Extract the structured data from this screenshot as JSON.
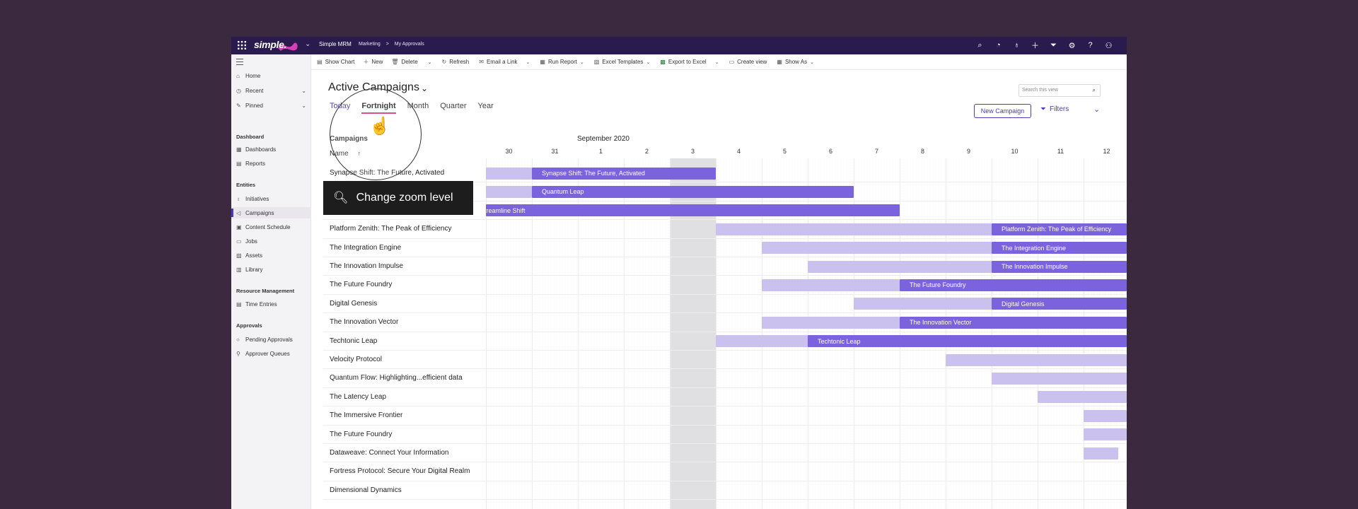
{
  "topbar": {
    "logo_text": "simple.",
    "app_name": "Simple MRM",
    "breadcrumb": [
      "Marketing",
      ">",
      "My Approvals"
    ],
    "icons": [
      "search-icon",
      "compass-icon",
      "lightbulb-icon",
      "plus-icon",
      "filter-icon",
      "settings-icon",
      "help-icon",
      "user-icon"
    ]
  },
  "nav": {
    "items": [
      {
        "label": "Home",
        "icon": "home-icon"
      },
      {
        "label": "Recent",
        "icon": "clock-icon",
        "expandable": true
      },
      {
        "label": "Pinned",
        "icon": "pin-icon",
        "expandable": true
      }
    ],
    "sections": [
      {
        "title": "Dashboard",
        "items": [
          {
            "label": "Dashboards"
          },
          {
            "label": "Reports"
          }
        ]
      },
      {
        "title": "Entities",
        "items": [
          {
            "label": "Initiatives"
          },
          {
            "label": "Campaigns",
            "active": true
          },
          {
            "label": "Content Schedule"
          },
          {
            "label": "Jobs"
          },
          {
            "label": "Assets"
          },
          {
            "label": "Library"
          }
        ]
      },
      {
        "title": "Resource Management",
        "items": [
          {
            "label": "Time Entries"
          }
        ]
      },
      {
        "title": "Approvals",
        "items": [
          {
            "label": "Pending Approvals"
          },
          {
            "label": "Approver Queues"
          }
        ]
      }
    ]
  },
  "toolbar": [
    {
      "label": "Show Chart",
      "icon": "chart-icon"
    },
    {
      "label": "New",
      "icon": "plus-icon"
    },
    {
      "label": "Delete",
      "icon": "trash-icon"
    },
    {
      "label": "",
      "icon": "chevron-down-icon"
    },
    {
      "label": "Refresh",
      "icon": "refresh-icon"
    },
    {
      "label": "Email a Link",
      "icon": "mail-icon"
    },
    {
      "label": "",
      "icon": "chevron-down-icon"
    },
    {
      "label": "Run Report",
      "icon": "report-icon",
      "caret": true
    },
    {
      "label": "Excel Templates",
      "icon": "excel-template-icon",
      "caret": true
    },
    {
      "label": "Export to Excel",
      "icon": "excel-icon"
    },
    {
      "label": "",
      "icon": "chevron-down-icon"
    },
    {
      "label": "Create view",
      "icon": "view-icon"
    },
    {
      "label": "Show As",
      "icon": "show-as-icon",
      "caret": true
    }
  ],
  "view": {
    "title": "Active Campaigns",
    "search_placeholder": "Search this view",
    "zoom_tabs": [
      "Today",
      "Fortnight",
      "Month",
      "Quarter",
      "Year"
    ],
    "active_zoom": "Fortnight",
    "new_campaign_label": "New Campaign",
    "filters_label": "Filters"
  },
  "gantt": {
    "campaigns_header": "Campaigns",
    "name_header": "Name",
    "sort_indicator": "↑",
    "month_label": "September 2020",
    "days": [
      "30",
      "31",
      "1",
      "2",
      "3",
      "4",
      "5",
      "6",
      "7",
      "8",
      "9",
      "10",
      "11",
      "12"
    ],
    "today_day_index": 4,
    "rows": [
      {
        "name": "Synapse Shift: The Future, Activated",
        "light_start": -1,
        "dark_start": 1,
        "dark_end": 5,
        "label": "Synapse Shift: The Future, Activated"
      },
      {
        "name": "",
        "light_start": -1,
        "dark_start": 1,
        "dark_end": 8,
        "label": "Quantum Leap"
      },
      {
        "name": "",
        "light_start": -1,
        "dark_start": -1,
        "dark_end": 9,
        "label": "The Streamline Shift"
      },
      {
        "name": "Platform Zenith: The Peak of Efficiency",
        "light_start": 5,
        "dark_start": 11,
        "dark_end": 15,
        "label": "Platform Zenith: The Peak of Efficiency"
      },
      {
        "name": "The Integration  Engine",
        "light_start": 6,
        "dark_start": 11,
        "dark_end": 15,
        "label": "The Integration Engine"
      },
      {
        "name": "The Innovation Impulse",
        "light_start": 7,
        "dark_start": 11,
        "dark_end": 15,
        "label": "The Innovation Impulse"
      },
      {
        "name": "The Future Foundry",
        "light_start": 6,
        "dark_start": 9,
        "dark_end": 15,
        "label": "The Future Foundry"
      },
      {
        "name": "Digital Genesis",
        "light_start": 8,
        "dark_start": 11,
        "dark_end": 15,
        "label": "Digital Genesis"
      },
      {
        "name": "The Innovation Vector",
        "light_start": 6,
        "dark_start": 9,
        "dark_end": 15,
        "label": "The Innovation Vector"
      },
      {
        "name": "Techtonic Leap",
        "light_start": 5,
        "dark_start": 7,
        "dark_end": 15,
        "label": "Techtonic Leap"
      },
      {
        "name": "Velocity Protocol",
        "light_start": 10,
        "dark_start": null,
        "dark_end": 15,
        "label": ""
      },
      {
        "name": "Quantum Flow: Highlighting...efficient data",
        "light_start": 11,
        "dark_start": null,
        "dark_end": 15,
        "label": ""
      },
      {
        "name": "The Latency Leap",
        "light_start": 12,
        "dark_start": null,
        "dark_end": 15,
        "label": ""
      },
      {
        "name": "The Immersive Frontier",
        "light_start": 13,
        "dark_start": null,
        "dark_end": 15,
        "label": ""
      },
      {
        "name": "The Future Foundry",
        "light_start": 13,
        "dark_start": null,
        "dark_end": 15,
        "label": ""
      },
      {
        "name": "Dataweave: Connect Your Information",
        "light_start": 13,
        "dark_start": null,
        "dark_end": 13.75,
        "label": ""
      },
      {
        "name": "Fortress Protocol: Secure Your Digital Realm",
        "light_start": null,
        "dark_start": null,
        "dark_end": null,
        "label": ""
      },
      {
        "name": "Dimensional Dynamics",
        "light_start": null,
        "dark_start": null,
        "dark_end": null,
        "label": ""
      }
    ]
  },
  "tooltip": {
    "text": "Change zoom level",
    "icon": "search-icon"
  },
  "colors": {
    "accent": "#4a3cb8",
    "bar_dark": "#7b63de",
    "bar_light": "#cbc1ef",
    "topbar": "#2a1b4f",
    "tab_underline": "#d0337f"
  }
}
